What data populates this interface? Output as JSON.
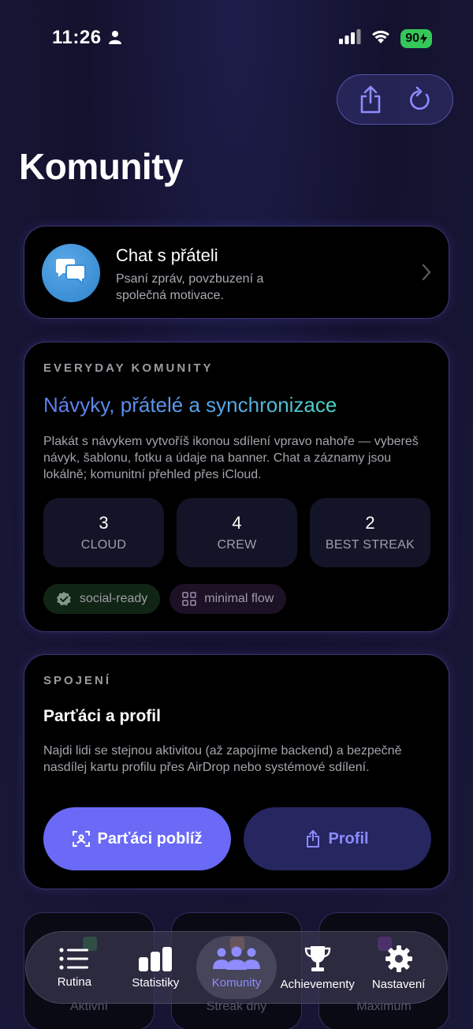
{
  "status_bar": {
    "time": "11:26",
    "battery": "90"
  },
  "page": {
    "title": "Komunity"
  },
  "chat_card": {
    "title": "Chat s přáteli",
    "subtitle": "Psaní zpráv, povzbuzení a společná motivace."
  },
  "everyday": {
    "eyebrow": "EVERYDAY KOMUNITY",
    "headline": "Návyky, přátelé a synchronizace",
    "body": "Plakát s návykem vytvoříš ikonou sdílení vpravo nahoře — vybereš návyk, šablonu, fotku a údaje na banner. Chat a záznamy jsou lokálně; komunitní přehled přes iCloud.",
    "stats": [
      {
        "value": "3",
        "label": "CLOUD"
      },
      {
        "value": "4",
        "label": "CREW"
      },
      {
        "value": "2",
        "label": "BEST STREAK"
      }
    ],
    "tags": [
      {
        "label": "social-ready",
        "icon": "verified-badge-icon",
        "color": "#112515"
      },
      {
        "label": "minimal flow",
        "icon": "grid-icon",
        "color": "#1d1126"
      }
    ]
  },
  "spojeni": {
    "eyebrow": "SPOJENÍ",
    "headline": "Parťáci a profil",
    "body": "Najdi lidi se stejnou aktivitou (až zapojíme backend) a bezpečně nasdílej kartu profilu přes AirDrop nebo systémové sdílení.",
    "primary_button": "Parťáci poblíž",
    "secondary_button": "Profil"
  },
  "mini_cards": [
    {
      "label": "Aktivní",
      "accent": "#1c8a2c"
    },
    {
      "label": "Streak dny",
      "accent": "#c0621a"
    },
    {
      "label": "Maximum",
      "accent": "#7a1ea8"
    }
  ],
  "tabbar": {
    "items": [
      {
        "label": "Rutina",
        "icon": "list-icon"
      },
      {
        "label": "Statistiky",
        "icon": "bar-chart-icon"
      },
      {
        "label": "Komunity",
        "icon": "people-icon",
        "active": true
      },
      {
        "label": "Achievementy",
        "icon": "trophy-icon"
      },
      {
        "label": "Nastavení",
        "icon": "gear-icon"
      }
    ]
  },
  "colors": {
    "accent": "#6a6af7",
    "card_border": "#6e64d2",
    "battery": "#34c759"
  }
}
